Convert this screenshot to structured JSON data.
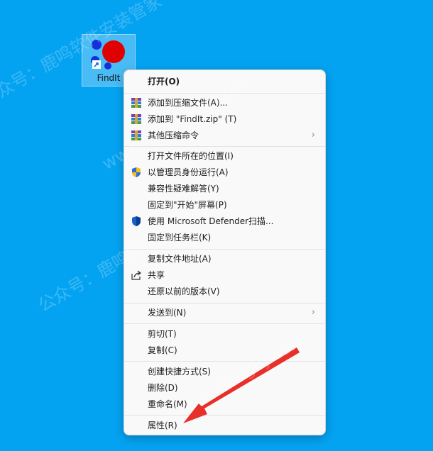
{
  "desktop_icon": {
    "label": "FindIt"
  },
  "menu": {
    "open": "打开(O)",
    "add_archive": "添加到压缩文件(A)...",
    "add_zip": "添加到 \"FindIt.zip\" (T)",
    "other_compress": "其他压缩命令",
    "open_location": "打开文件所在的位置(I)",
    "run_as_admin": "以管理员身份运行(A)",
    "troubleshoot": "兼容性疑难解答(Y)",
    "pin_start": "固定到\"开始\"屏幕(P)",
    "defender_scan": "使用 Microsoft Defender扫描...",
    "pin_taskbar": "固定到任务栏(K)",
    "copy_path": "复制文件地址(A)",
    "share": "共享",
    "restore_versions": "还原以前的版本(V)",
    "send_to": "发送到(N)",
    "cut": "剪切(T)",
    "copy": "复制(C)",
    "create_shortcut": "创建快捷方式(S)",
    "delete": "删除(D)",
    "rename": "重命名(M)",
    "properties": "属性(R)"
  },
  "watermark": {
    "text_cn": "公众号：鹿鸣软件安装管家",
    "text_en": "www.LuMingRJ.com"
  },
  "colors": {
    "desktop": "#04a3f2",
    "menu_bg": "#f9f9f9",
    "arrow": "#e8302a"
  }
}
